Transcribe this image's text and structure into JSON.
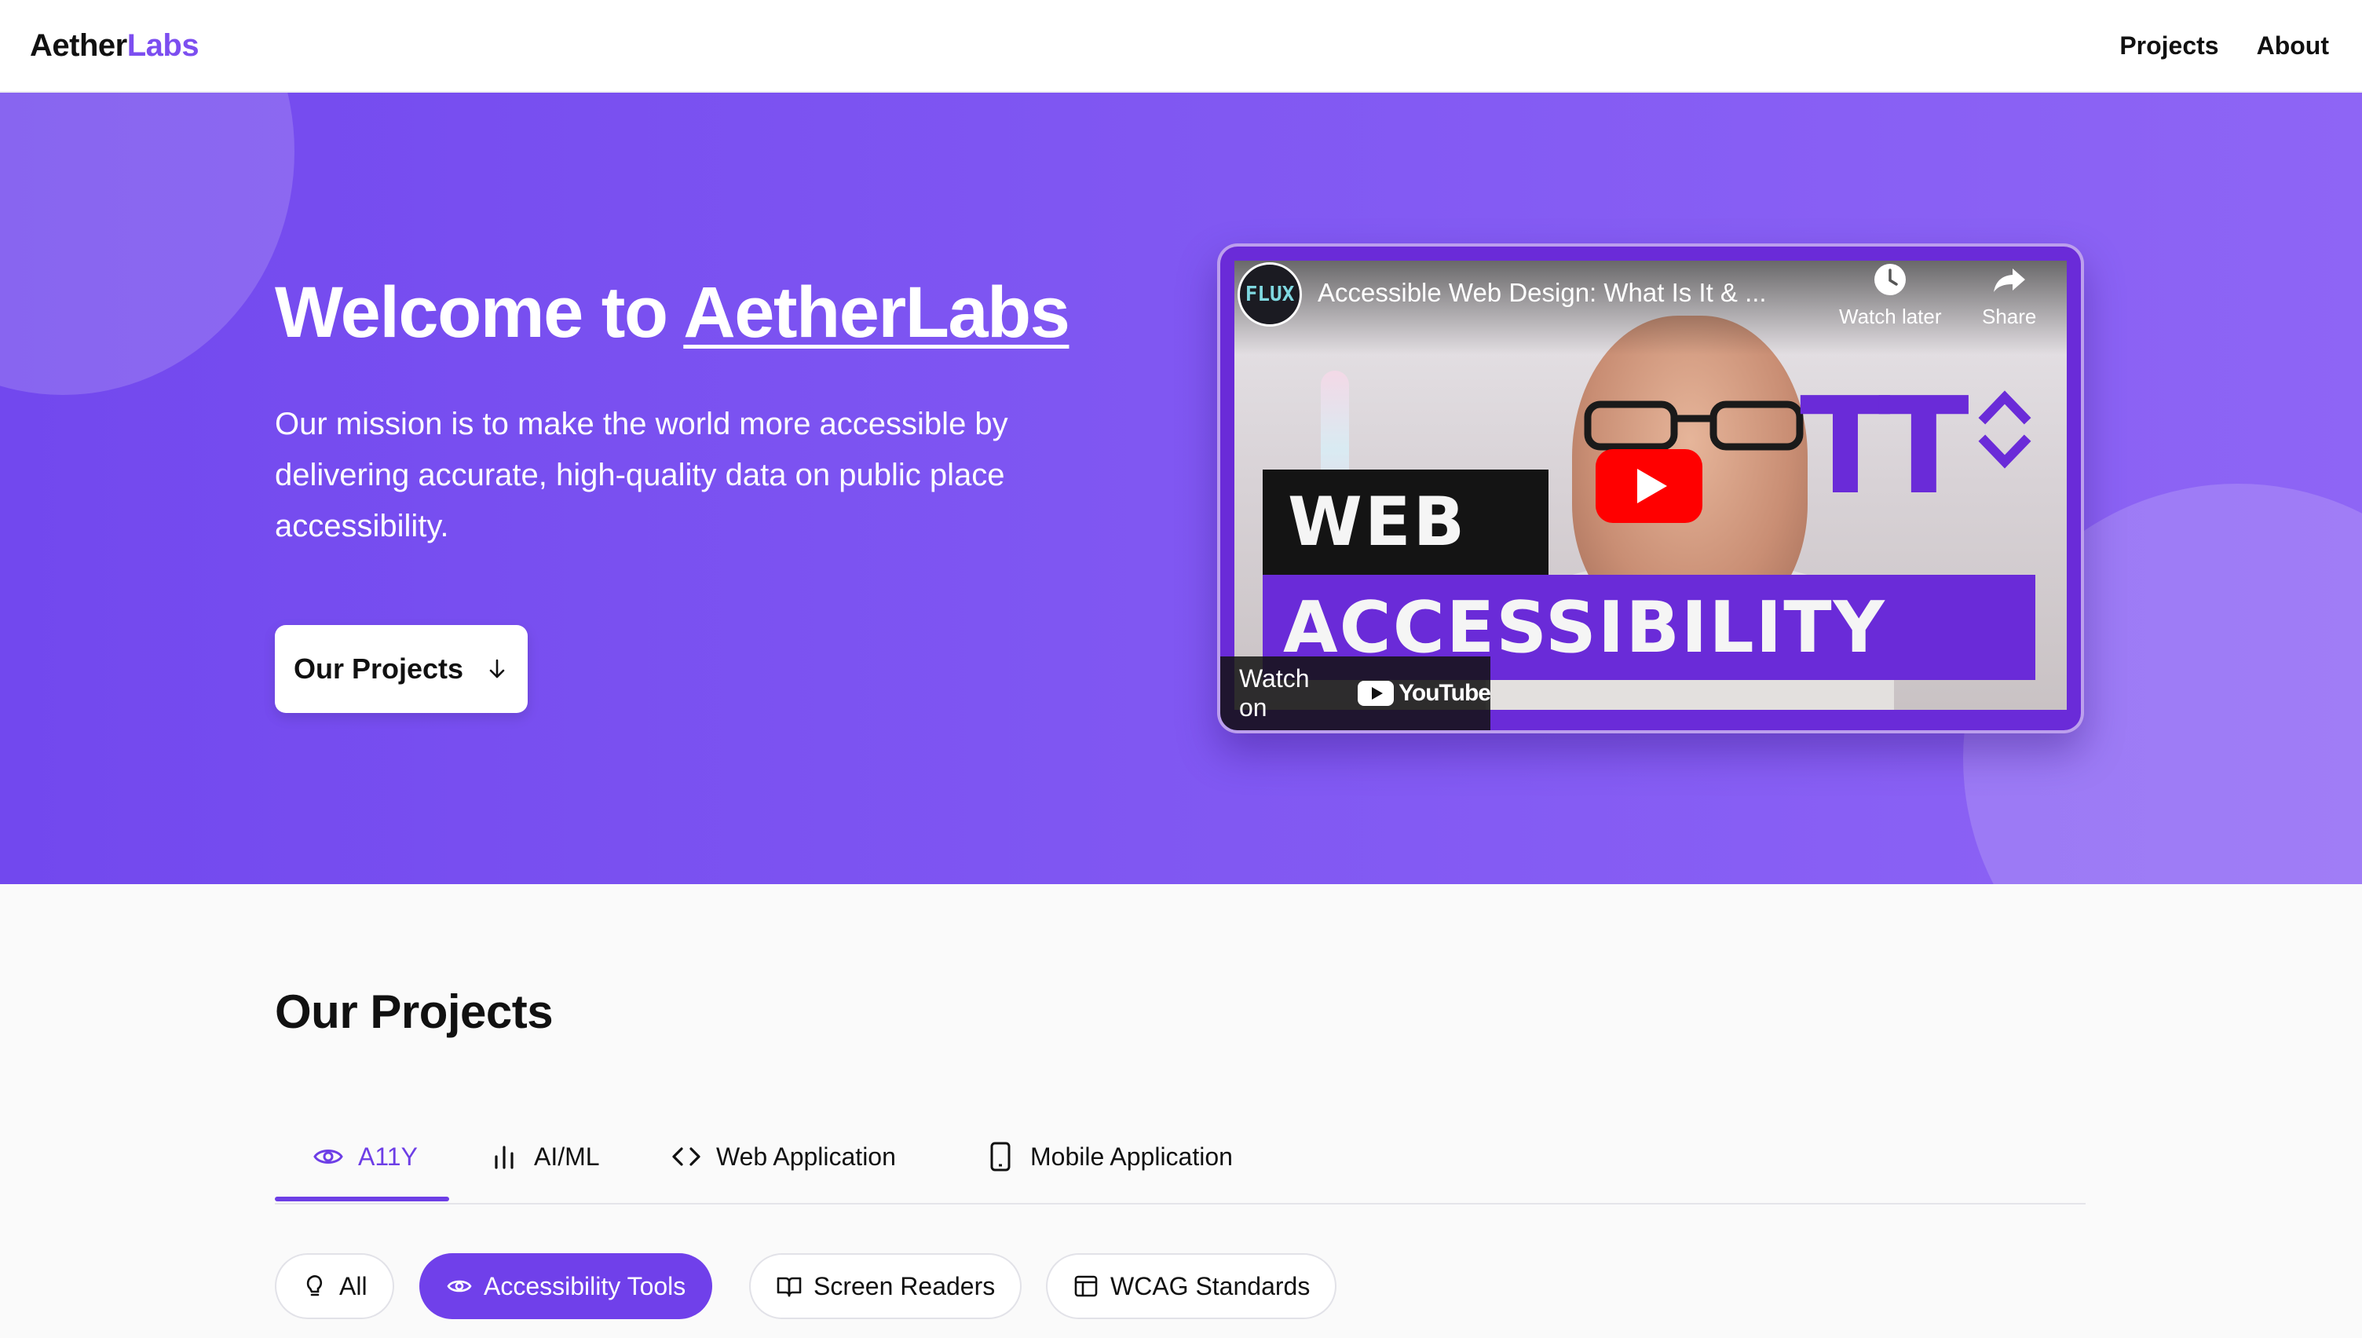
{
  "header": {
    "logo_part1": "Aether",
    "logo_part2": "Labs",
    "nav": [
      "Projects",
      "About"
    ]
  },
  "hero": {
    "title_prefix": "Welcome to ",
    "title_brand": "AetherLabs",
    "description": "Our mission is to make the world more accessible by delivering accurate, high-quality data on public place accessibility.",
    "cta_label": "Our Projects",
    "cta_icon": "arrow-down-icon"
  },
  "video": {
    "channel_logo_text": "FLUX",
    "title": "Accessible Web Design: What Is It & ...",
    "watch_later": "Watch later",
    "share": "Share",
    "band_top": "WEB",
    "band_bottom": "ACCESSIBILITY",
    "big_letters": "TT",
    "watch_on": "Watch on",
    "youtube": "YouTube"
  },
  "projects": {
    "title": "Our Projects",
    "tabs": [
      {
        "label": "A11Y",
        "icon": "eye-icon",
        "active": true
      },
      {
        "label": "AI/ML",
        "icon": "bar-chart-icon",
        "active": false
      },
      {
        "label": "Web Application",
        "icon": "code-icon",
        "active": false
      },
      {
        "label": "Mobile Application",
        "icon": "smartphone-icon",
        "active": false
      }
    ],
    "filters": [
      {
        "label": "All",
        "icon": "lightbulb-icon",
        "active": false
      },
      {
        "label": "Accessibility Tools",
        "icon": "eye-icon",
        "active": true
      },
      {
        "label": "Screen Readers",
        "icon": "book-open-icon",
        "active": false
      },
      {
        "label": "WCAG Standards",
        "icon": "layout-icon",
        "active": false
      }
    ]
  },
  "colors": {
    "accent": "#7040ea",
    "hero_start": "#7248ee",
    "hero_end": "#8e65f5",
    "youtube_red": "#ff0000"
  }
}
